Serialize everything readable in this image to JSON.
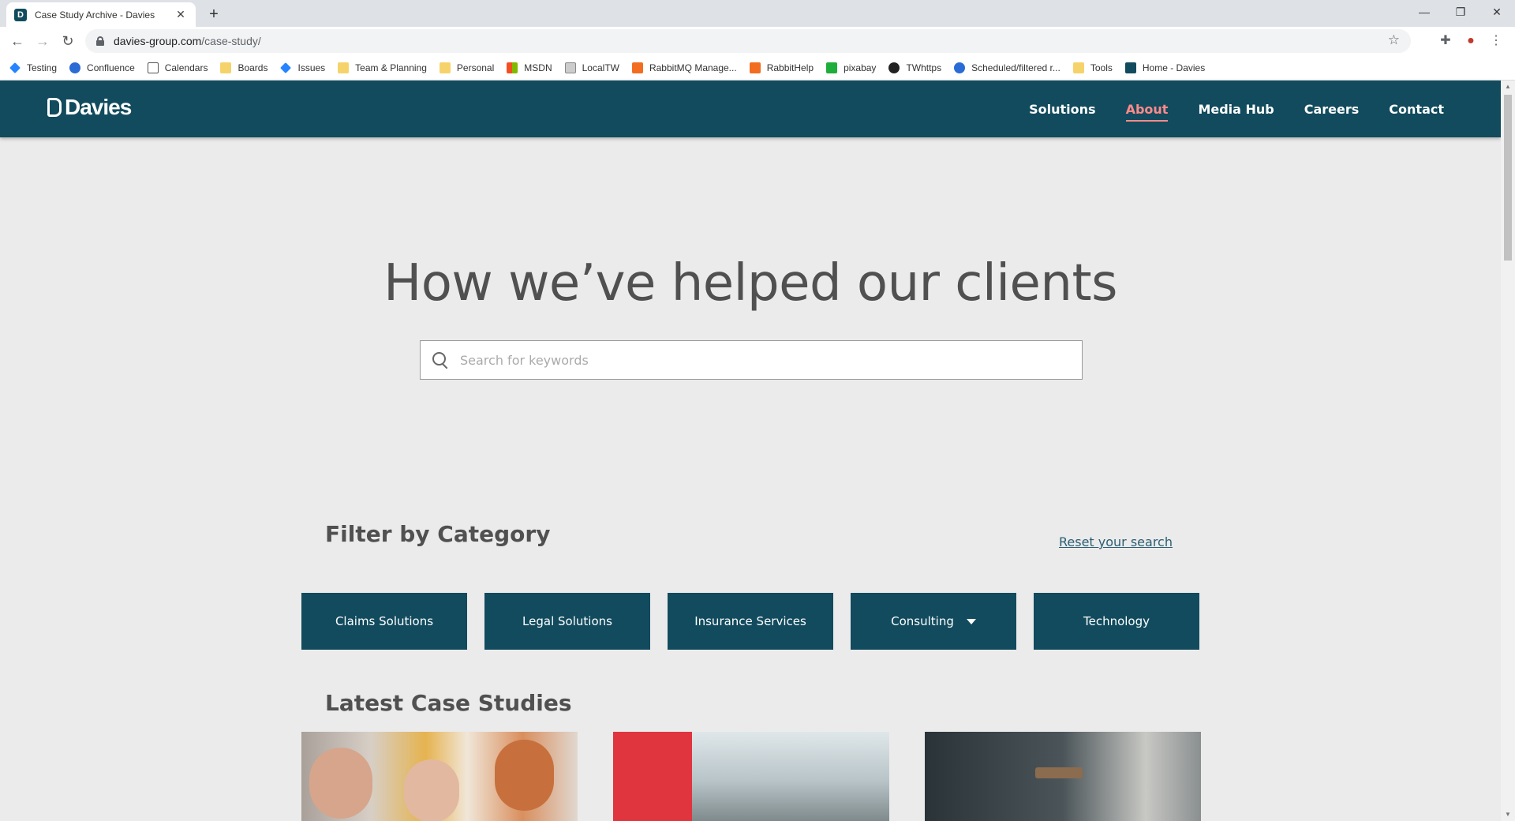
{
  "browser": {
    "tab_title": "Case Study Archive - Davies",
    "tab_close": "✕",
    "new_tab": "+",
    "url_host": "davies-group.com",
    "url_path": "/case-study/",
    "window_minimize": "—",
    "window_restore": "❐",
    "window_close": "✕"
  },
  "bookmarks": [
    {
      "label": "Testing",
      "icon": "jira-icon"
    },
    {
      "label": "Confluence",
      "icon": "confluence-icon"
    },
    {
      "label": "Calendars",
      "icon": "calendar-icon"
    },
    {
      "label": "Boards",
      "icon": "folder-icon"
    },
    {
      "label": "Issues",
      "icon": "jira-icon"
    },
    {
      "label": "Team & Planning",
      "icon": "folder-icon"
    },
    {
      "label": "Personal",
      "icon": "folder-icon"
    },
    {
      "label": "MSDN",
      "icon": "microsoft-icon"
    },
    {
      "label": "LocalTW",
      "icon": "local-icon"
    },
    {
      "label": "RabbitMQ Manage...",
      "icon": "rabbitmq-icon"
    },
    {
      "label": "RabbitHelp",
      "icon": "rabbitmq-icon"
    },
    {
      "label": "pixabay",
      "icon": "pixabay-icon"
    },
    {
      "label": "TWhttps",
      "icon": "tw-icon"
    },
    {
      "label": "Scheduled/filtered r...",
      "icon": "confluence-icon"
    },
    {
      "label": "Tools",
      "icon": "folder-icon"
    },
    {
      "label": "Home - Davies",
      "icon": "davies-icon"
    }
  ],
  "site": {
    "logo_text": "Davies",
    "nav": [
      {
        "label": "Solutions",
        "active": false
      },
      {
        "label": "About",
        "active": true
      },
      {
        "label": "Media Hub",
        "active": false
      },
      {
        "label": "Careers",
        "active": false
      },
      {
        "label": "Contact",
        "active": false
      }
    ]
  },
  "hero": {
    "title": "How we’ve helped our clients",
    "search_placeholder": "Search for keywords",
    "search_value": ""
  },
  "filter": {
    "title": "Filter by Category",
    "reset_label": "Reset your search",
    "categories": [
      {
        "label": "Claims Solutions",
        "has_dropdown": false
      },
      {
        "label": "Legal Solutions",
        "has_dropdown": false
      },
      {
        "label": "Insurance Services",
        "has_dropdown": false
      },
      {
        "label": "Consulting",
        "has_dropdown": true
      },
      {
        "label": "Technology",
        "has_dropdown": false
      }
    ]
  },
  "latest": {
    "title": "Latest Case Studies"
  },
  "colors": {
    "brand": "#124b5e",
    "nav_active": "#ff8a8a",
    "page_bg": "#ebebeb"
  }
}
